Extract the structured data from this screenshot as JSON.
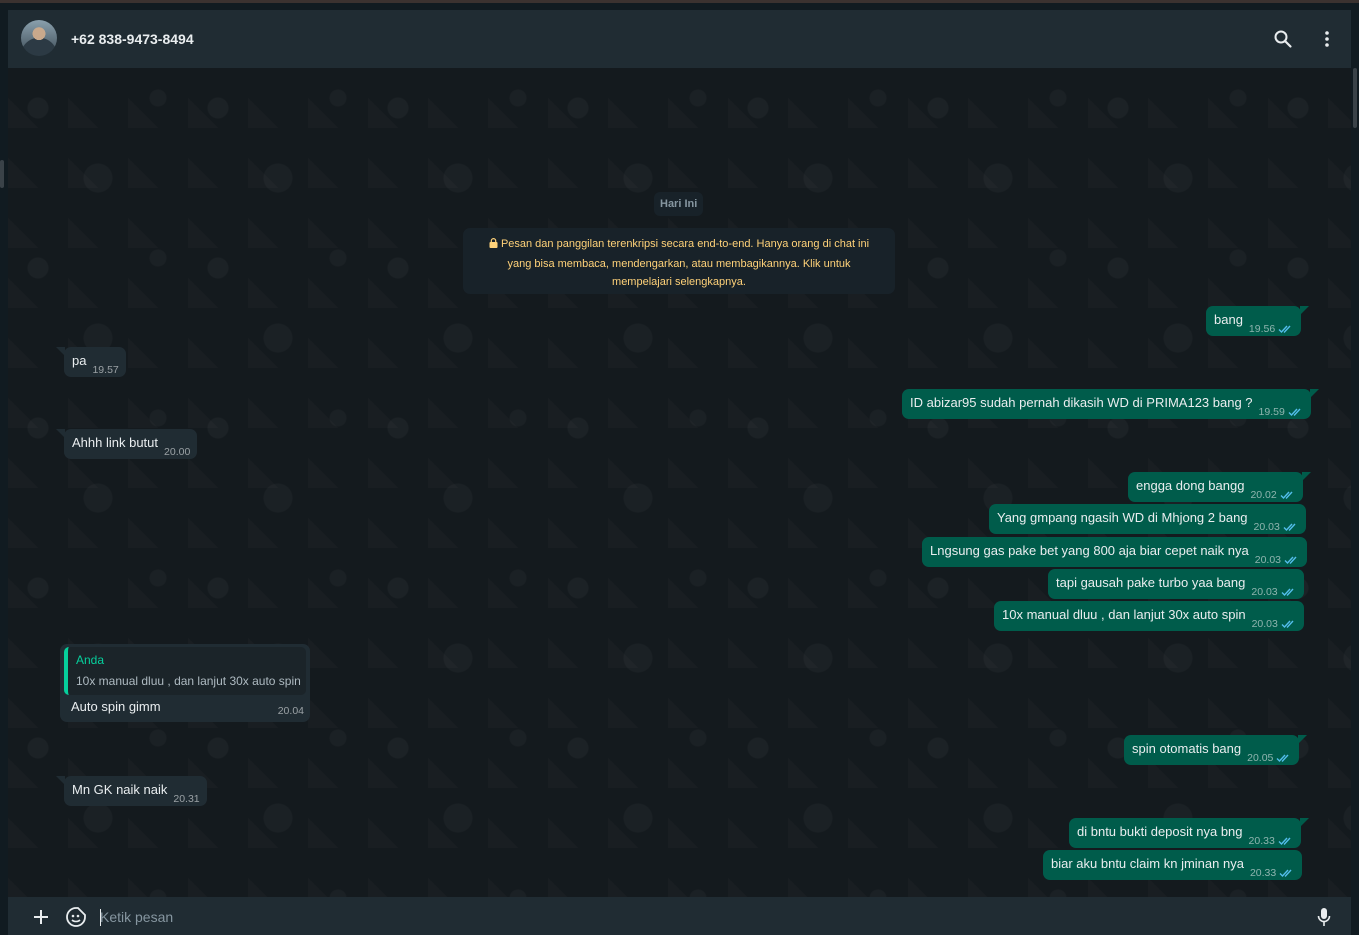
{
  "header": {
    "contact_name": "+62 838-9473-8494",
    "icons": [
      "search-icon",
      "menu-icon"
    ]
  },
  "chat": {
    "date_label": "Hari Ini",
    "encryption_notice": "Pesan dan panggilan terenkripsi secara end-to-end. Hanya orang di chat ini yang bisa membaca, mendengarkan, atau membagikannya. Klik untuk mempelajari selengkapnya.",
    "messages": [
      {
        "dir": "out",
        "text": "bang",
        "time": "19.56"
      },
      {
        "dir": "in",
        "text": "pa",
        "time": "19.57"
      },
      {
        "dir": "out",
        "text": "ID abizar95 sudah pernah dikasih WD di PRIMA123 bang ?",
        "time": "19.59"
      },
      {
        "dir": "in",
        "text": "Ahhh link butut",
        "time": "20.00"
      },
      {
        "dir": "out",
        "text": "engga dong bangg",
        "time": "20.02"
      },
      {
        "dir": "out",
        "text": "Yang gmpang ngasih WD di Mhjong 2 bang",
        "time": "20.03"
      },
      {
        "dir": "out",
        "text": "Lngsung gas pake bet yang 800 aja biar cepet naik nya",
        "time": "20.03"
      },
      {
        "dir": "out",
        "text": "tapi gausah pake turbo yaa bang",
        "time": "20.03"
      },
      {
        "dir": "out",
        "text": "10x manual dluu , dan lanjut 30x auto spin",
        "time": "20.03"
      },
      {
        "dir": "in",
        "quote_author": "Anda",
        "quote_text": "10x manual dluu , dan lanjut 30x auto spin",
        "text": "Auto spin gimm",
        "time": "20.04"
      },
      {
        "dir": "out",
        "text": "spin otomatis bang",
        "time": "20.05"
      },
      {
        "dir": "in",
        "text": "Mn GK naik naik",
        "time": "20.31"
      },
      {
        "dir": "out",
        "text": "di bntu bukti deposit nya bng",
        "time": "20.33"
      },
      {
        "dir": "out",
        "text": "biar aku bntu claim kn jminan nya",
        "time": "20.33"
      }
    ]
  },
  "composer": {
    "placeholder": "Ketik pesan",
    "icons": [
      "plus-icon",
      "sticker-icon",
      "mic-icon"
    ]
  },
  "colors": {
    "outgoing_bubble": "#005c4b",
    "incoming_bubble": "#202c33",
    "notice_text": "#ffd279",
    "quote_accent": "#06cf9c",
    "read_ticks": "#53bdeb"
  }
}
